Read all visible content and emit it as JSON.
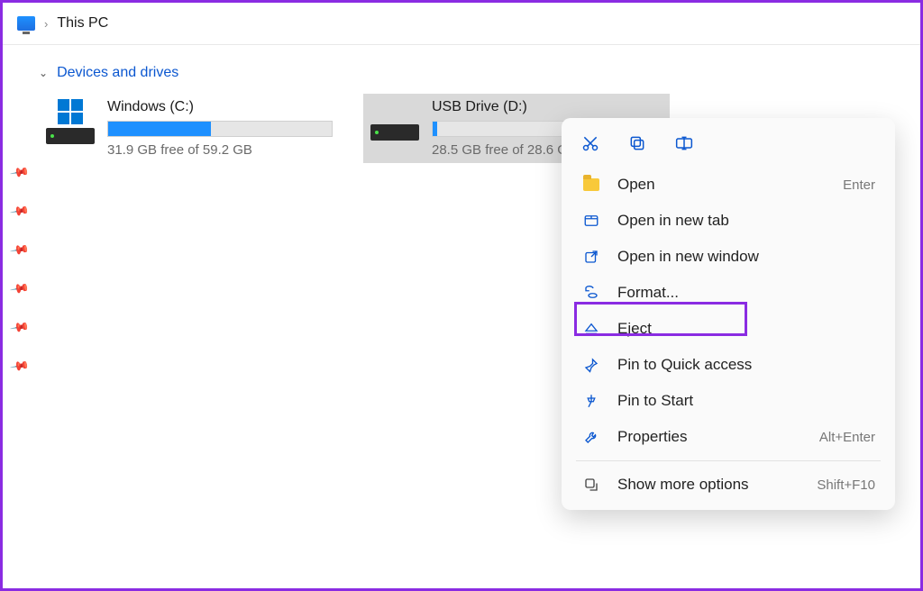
{
  "breadcrumb": {
    "location": "This PC"
  },
  "section": {
    "title": "Devices and drives"
  },
  "drives": [
    {
      "name": "Windows (C:)",
      "usage_text": "31.9 GB free of 59.2 GB",
      "fill_percent": 46,
      "selected": false,
      "icon": "windows"
    },
    {
      "name": "USB Drive (D:)",
      "usage_text": "28.5 GB free of 28.6 GB",
      "fill_percent": 1,
      "selected": true,
      "icon": "usb"
    }
  ],
  "context_menu": {
    "toolbar": [
      "cut",
      "copy",
      "rename"
    ],
    "items": [
      {
        "label": "Open",
        "shortcut": "Enter",
        "icon": "folder"
      },
      {
        "label": "Open in new tab",
        "shortcut": "",
        "icon": "tab"
      },
      {
        "label": "Open in new window",
        "shortcut": "",
        "icon": "window"
      },
      {
        "label": "Format...",
        "shortcut": "",
        "icon": "format",
        "highlight": true
      },
      {
        "label": "Eject",
        "shortcut": "",
        "icon": "eject"
      },
      {
        "label": "Pin to Quick access",
        "shortcut": "",
        "icon": "pin"
      },
      {
        "label": "Pin to Start",
        "shortcut": "",
        "icon": "pin2"
      },
      {
        "label": "Properties",
        "shortcut": "Alt+Enter",
        "icon": "wrench"
      }
    ],
    "more": {
      "label": "Show more options",
      "shortcut": "Shift+F10",
      "icon": "more"
    }
  }
}
